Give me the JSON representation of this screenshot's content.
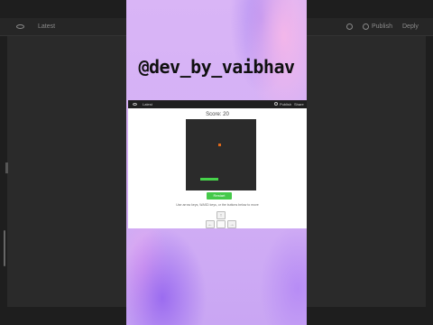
{
  "background_editor": {
    "tab_label": "Latest",
    "publish_label": "Publish",
    "deploy_label": "Deply"
  },
  "watermark": {
    "handle": "@dev_by_vaibhav"
  },
  "app": {
    "topbar": {
      "tab_label": "Latest",
      "publish_label": "Publish",
      "menu_label": "Share"
    },
    "score_text": "Score: 20",
    "restart_label": "Restart",
    "instructions": "Use arrow keys, WASD keys, or the buttons below to move",
    "controls": {
      "up": "↑",
      "left": "←",
      "right": "→"
    },
    "colors": {
      "canvas": "#2b2b2b",
      "snake": "#46d24a",
      "food": "#e0691a",
      "restart_button": "#45c94a"
    }
  }
}
